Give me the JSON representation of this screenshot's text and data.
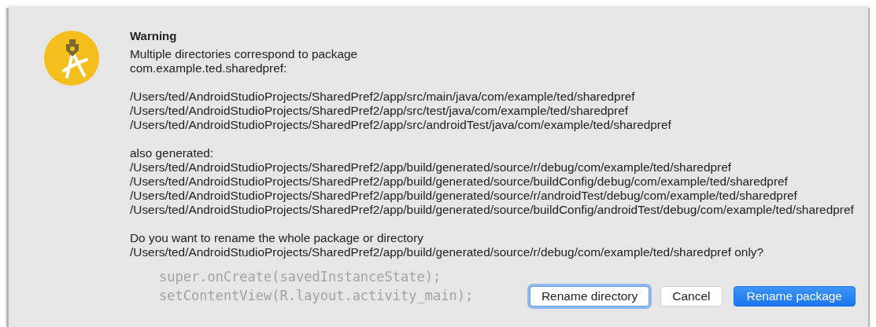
{
  "dialog": {
    "title": "Warning",
    "message": [
      "Multiple directories correspond to package",
      "com.example.ted.sharedpref:"
    ],
    "source_paths": [
      "/Users/ted/AndroidStudioProjects/SharedPref2/app/src/main/java/com/example/ted/sharedpref",
      "/Users/ted/AndroidStudioProjects/SharedPref2/app/src/test/java/com/example/ted/sharedpref",
      "/Users/ted/AndroidStudioProjects/SharedPref2/app/src/androidTest/java/com/example/ted/sharedpref"
    ],
    "generated_label": "also generated:",
    "generated_paths": [
      "/Users/ted/AndroidStudioProjects/SharedPref2/app/build/generated/source/r/debug/com/example/ted/sharedpref",
      "/Users/ted/AndroidStudioProjects/SharedPref2/app/build/generated/source/buildConfig/debug/com/example/ted/sharedpref",
      "/Users/ted/AndroidStudioProjects/SharedPref2/app/build/generated/source/r/androidTest/debug/com/example/ted/sharedpref",
      "/Users/ted/AndroidStudioProjects/SharedPref2/app/build/generated/source/buildConfig/androidTest/debug/com/example/ted/sharedpref"
    ],
    "question": [
      "Do you want to rename the whole package or directory",
      "/Users/ted/AndroidStudioProjects/SharedPref2/app/build/generated/source/r/debug/com/example/ted/sharedpref only?"
    ],
    "buttons": [
      {
        "label": "Rename directory",
        "kind": "focused"
      },
      {
        "label": "Cancel",
        "kind": "normal"
      },
      {
        "label": "Rename package",
        "kind": "default"
      }
    ]
  },
  "background_code": [
    "super.onCreate(savedInstanceState);",
    "setContentView(R.layout.activity_main);"
  ]
}
